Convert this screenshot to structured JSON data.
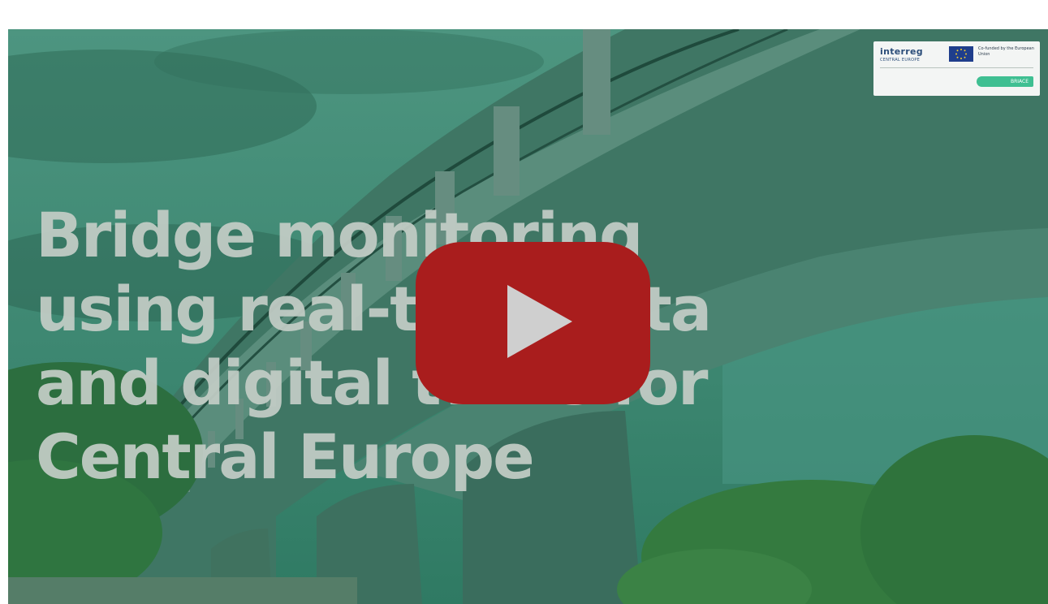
{
  "video": {
    "title_lines": [
      "Bridge monitoring",
      "using real-time data",
      "and digital twins for",
      "Central Europe"
    ]
  },
  "logo": {
    "brand": "interreg",
    "brand_sub": "CENTRAL EUROPE",
    "eu_text": "Co-funded by the European Union",
    "project": "BRIACE"
  },
  "play_button": {
    "icon": "play-icon",
    "color": "#a91d1d"
  },
  "colors": {
    "overlay_tint": "#3f8a72",
    "title_text": "#c3cdc6",
    "project_tag": "#3fbf92"
  }
}
